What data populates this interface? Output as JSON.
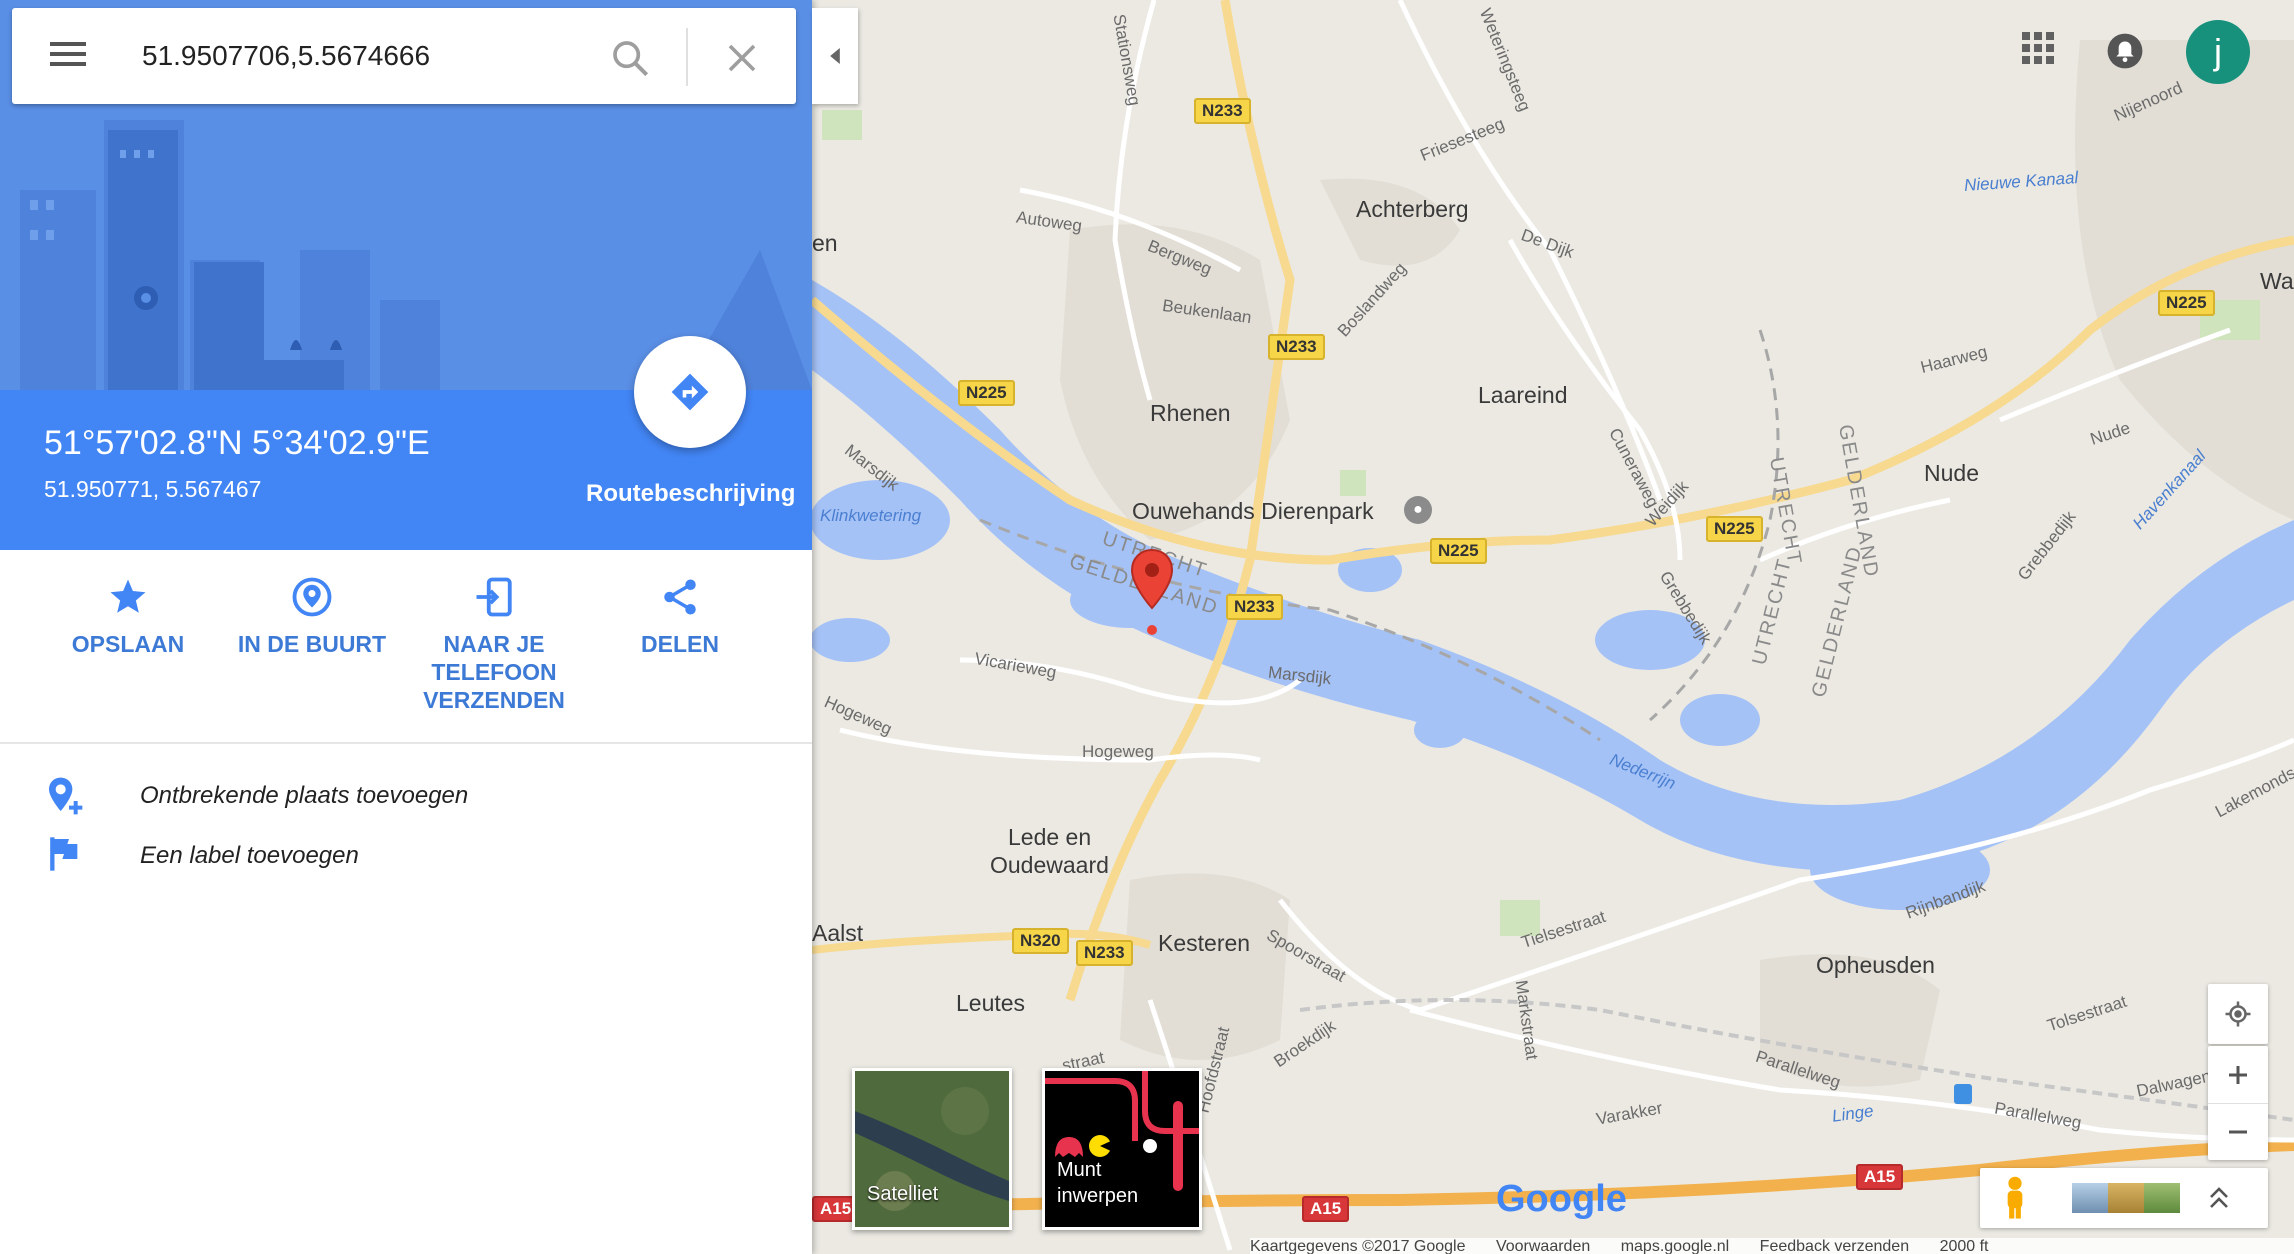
{
  "search": {
    "value": "51.9507706,5.5674666"
  },
  "place": {
    "coord_dms": "51°57'02.8\"N 5°34'02.9\"E",
    "coord_decimal": "51.950771, 5.567467",
    "route_label": "Routebeschrijving"
  },
  "actions": [
    {
      "label": "OPSLAAN",
      "icon": "star-icon"
    },
    {
      "label": "IN DE BUURT",
      "icon": "nearby-icon"
    },
    {
      "label": "NAAR JE TELEFOON VERZENDEN",
      "icon": "send-to-phone-icon"
    },
    {
      "label": "DELEN",
      "icon": "share-icon"
    }
  ],
  "extra": [
    {
      "label": "Ontbrekende plaats toevoegen",
      "icon": "add-place-icon"
    },
    {
      "label": "Een label toevoegen",
      "icon": "flag-icon"
    }
  ],
  "map": {
    "places": {
      "achterberg": "Achterberg",
      "rhenen": "Rhenen",
      "laareind": "Laareind",
      "ouwehands": "Ouwehands Dierenpark",
      "nude": "Nude",
      "lede": "Lede en",
      "oudewaard": "Oudewaard",
      "kesteren": "Kesteren",
      "leutes": "Leutes",
      "opheusden": "Opheusden",
      "aalst": "Aalst",
      "wager": "Wager",
      "en": "en"
    },
    "roads": {
      "autoweg": "Autoweg",
      "bergweg": "Bergweg",
      "beukenlaan": "Beukenlaan",
      "boslandweg": "Boslandweg",
      "friesesteeg": "Friesesteeg",
      "wateringsteeg": "Weteringsteeg",
      "dedijk": "De Dijk",
      "haarweg": "Haarweg",
      "nude_road": "Nude",
      "cuneraweg": "Cuneraweg",
      "weidijk": "Weidijk",
      "grebbedijk": "Grebbedijk",
      "grebbedijk2": "Grebbedijk",
      "marsdijk": "Marsdijk",
      "marsdijk2": "Marsdijk",
      "vicarieweg": "Vicarieweg",
      "hogeweg": "Hogeweg",
      "hogeweg2": "Hogeweg",
      "spoorstraat": "Spoorstraat",
      "tielsestraat": "Tielsestraat",
      "rijnbandijk": "Rijnbandijk",
      "tolsestraat": "Tolsestraat",
      "parallelweg": "Parallelweg",
      "parallelweg2": "Parallelweg",
      "dalwagen": "Dalwagen",
      "varakker": "Varakker",
      "broekdijk": "Broekdijk",
      "hoofdstraat": "Hoofdstraat",
      "markstraat": "Markstraat",
      "lakemondsestraat": "Lakemondsestr",
      "nijenoord": "Nijenoord",
      "stationsweg": "Stationsweg",
      "straat": "straat"
    },
    "water": {
      "nederrijn": "Nederrijn",
      "klinkwetering": "Klinkwetering",
      "nieuwekanaal": "Nieuwe Kanaal",
      "havenkanaal": "Havenkanaal",
      "linge": "Linge"
    },
    "provinces": {
      "utrecht1": "UTRECHT",
      "gelderland1": "GELDERLAND",
      "utrecht2": "UTRECHT",
      "gelderland2": "GELDERLAND",
      "utrecht3": "UTRECHT",
      "gelderland3": "GELDERLAND"
    },
    "shields": {
      "n233a": "N233",
      "n233b": "N233",
      "n233c": "N233",
      "n233d": "N233",
      "n225a": "N225",
      "n225b": "N225",
      "n225c": "N225",
      "n225d": "N225",
      "n320": "N320",
      "a15a": "A15",
      "a15b": "A15",
      "a15c": "A15"
    }
  },
  "thumbs": {
    "satellite": "Satelliet",
    "coin_line1": "Munt",
    "coin_line2": "inwerpen"
  },
  "account": {
    "initial": "j"
  },
  "logo": "Google",
  "footer": {
    "data": "Kaartgegevens ©2017 Google",
    "terms": "Voorwaarden",
    "domain": "maps.google.nl",
    "feedback": "Feedback verzenden",
    "scale": "2000 ft"
  },
  "colors": {
    "accent": "#4285f4",
    "water": "#a5c2f7",
    "shield": "#f6d548",
    "pin": "#ea4335"
  }
}
